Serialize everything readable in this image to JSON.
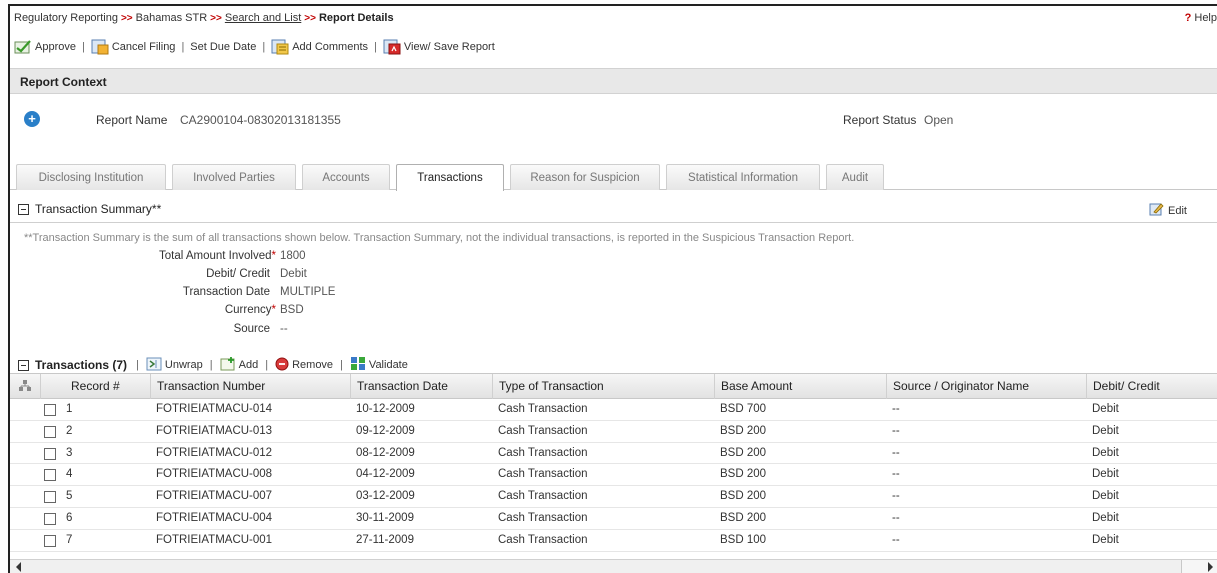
{
  "breadcrumb": {
    "items": [
      "Regulatory Reporting",
      "Bahamas STR",
      "Search and List",
      "Report Details"
    ],
    "separator": ">>"
  },
  "help": {
    "label": "Help",
    "glyph": "?"
  },
  "toolbar": {
    "approve": "Approve",
    "cancel_filing": "Cancel Filing",
    "set_due_date": "Set Due Date",
    "add_comments": "Add Comments",
    "view_save_report": "View/ Save Report",
    "separator": "|"
  },
  "report_context": {
    "title": "Report Context",
    "report_name_label": "Report Name",
    "report_name_value": "CA2900104-08302013181355",
    "report_status_label": "Report Status",
    "report_status_value": "Open"
  },
  "tabs": [
    {
      "label": "Disclosing Institution",
      "active": false
    },
    {
      "label": "Involved Parties",
      "active": false
    },
    {
      "label": "Accounts",
      "active": false
    },
    {
      "label": "Transactions",
      "active": true
    },
    {
      "label": "Reason for Suspicion",
      "active": false
    },
    {
      "label": "Statistical Information",
      "active": false
    },
    {
      "label": "Audit",
      "active": false
    }
  ],
  "summary": {
    "title": "Transaction Summary**",
    "edit_label": "Edit",
    "note": "**Transaction Summary is the sum of all transactions shown below. Transaction Summary, not the individual transactions, is reported in the Suspicious Transaction Report.",
    "fields": [
      {
        "label": "Total Amount Involved",
        "required": true,
        "value": "1800"
      },
      {
        "label": "Debit/ Credit",
        "required": false,
        "value": "Debit"
      },
      {
        "label": "Transaction Date",
        "required": false,
        "value": "MULTIPLE"
      },
      {
        "label": "Currency",
        "required": true,
        "value": "BSD"
      },
      {
        "label": "Source",
        "required": false,
        "value": "--"
      }
    ],
    "required_marker": "*"
  },
  "transactions": {
    "title": "Transactions (7)",
    "unwrap": "Unwrap",
    "add": "Add",
    "remove": "Remove",
    "validate": "Validate",
    "columns": [
      "Record #",
      "Transaction Number",
      "Transaction Date",
      "Type of Transaction",
      "Base Amount",
      "Source / Originator Name",
      "Debit/ Credit"
    ],
    "rows": [
      [
        "1",
        "FOTRIEIATMACU-014",
        "10-12-2009",
        "Cash Transaction",
        "BSD 700",
        "--",
        "Debit"
      ],
      [
        "2",
        "FOTRIEIATMACU-013",
        "09-12-2009",
        "Cash Transaction",
        "BSD 200",
        "--",
        "Debit"
      ],
      [
        "3",
        "FOTRIEIATMACU-012",
        "08-12-2009",
        "Cash Transaction",
        "BSD 200",
        "--",
        "Debit"
      ],
      [
        "4",
        "FOTRIEIATMACU-008",
        "04-12-2009",
        "Cash Transaction",
        "BSD 200",
        "--",
        "Debit"
      ],
      [
        "5",
        "FOTRIEIATMACU-007",
        "03-12-2009",
        "Cash Transaction",
        "BSD 200",
        "--",
        "Debit"
      ],
      [
        "6",
        "FOTRIEIATMACU-004",
        "30-11-2009",
        "Cash Transaction",
        "BSD 200",
        "--",
        "Debit"
      ],
      [
        "7",
        "FOTRIEIATMACU-001",
        "27-11-2009",
        "Cash Transaction",
        "BSD 100",
        "--",
        "Debit"
      ]
    ]
  },
  "colors": {
    "separator_red": "#c00000",
    "plus_blue": "#2a7fc8",
    "header_gray": "#e8e8e8"
  }
}
